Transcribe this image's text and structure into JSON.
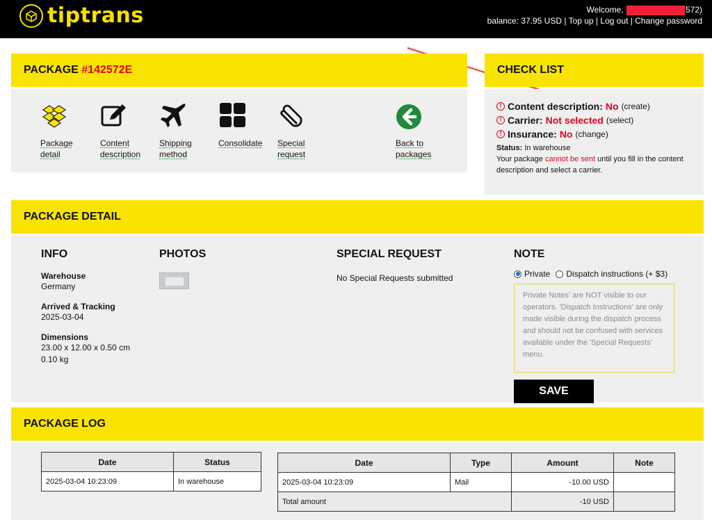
{
  "header": {
    "brand": "tiptrans",
    "welcome_prefix": "Welcome,",
    "welcome_suffix": "572)",
    "balance": "balance: 37.95 USD",
    "links": [
      "Top up",
      "Log out",
      "Change password"
    ]
  },
  "package": {
    "title_prefix": "PACKAGE",
    "id": "#142572E",
    "nav": [
      {
        "label_1": "Package",
        "label_2": "detail",
        "icon": "boxes-icon"
      },
      {
        "label_1": "Content",
        "label_2": "description",
        "icon": "edit-icon"
      },
      {
        "label_1": "Shipping",
        "label_2": "method",
        "icon": "airplane-icon"
      },
      {
        "label_1": "Consolidate",
        "label_2": "",
        "icon": "grid-icon"
      },
      {
        "label_1": "Special",
        "label_2": "request",
        "icon": "paperclip-icon"
      },
      {
        "label_1": "Back to",
        "label_2": "packages",
        "icon": "back-arrow-icon"
      }
    ]
  },
  "checklist": {
    "title": "CHECK LIST",
    "content_label": "Content description:",
    "content_value": "No",
    "content_action": "(create)",
    "carrier_label": "Carrier:",
    "carrier_value": "Not selected",
    "carrier_action": "(select)",
    "insurance_label": "Insurance:",
    "insurance_value": "No",
    "insurance_action": "(change)",
    "status_label": "Status:",
    "status_value": "In warehouse",
    "note_1": "Your package",
    "note_red": "cannot be sent",
    "note_2": "until you fill in the",
    "note_3": "content description and select a carrier."
  },
  "detail": {
    "title": "PACKAGE DETAIL",
    "info_title": "INFO",
    "warehouse_label": "Warehouse",
    "warehouse_value": "Germany",
    "arrived_label": "Arrived & Tracking",
    "arrived_value": "2025-03-04",
    "dimensions_label": "Dimensions",
    "dimensions_value": "23.00 x 12.00 x 0.50 cm",
    "weight_value": "0.10 kg",
    "photos_title": "PHOTOS",
    "special_title": "SPECIAL REQUEST",
    "special_value": "No Special Requests submitted",
    "note_title": "NOTE",
    "radio_private": "Private",
    "radio_dispatch": "Dispatch instructions (+ $3)",
    "note_placeholder": "Private Notes' are NOT visible to our operators. 'Dispatch Instructions' are only made visible during the dispatch process and should not be confused with services available under the 'Special Requests' menu.",
    "save_label": "SAVE"
  },
  "log": {
    "title": "PACKAGE LOG",
    "status_table": {
      "headers": [
        "Date",
        "Status"
      ],
      "rows": [
        [
          "2025-03-04 10:23:09",
          "In warehouse"
        ]
      ]
    },
    "payment_table": {
      "headers": [
        "Date",
        "Type",
        "Amount",
        "Note"
      ],
      "rows": [
        [
          "2025-03-04 10:23:09",
          "Mail",
          "-10.00 USD",
          ""
        ]
      ],
      "total_label": "Total amount",
      "total_value": "-10 USD"
    }
  },
  "colors": {
    "accent": "#f8e400",
    "alert": "#e3001b",
    "back_button": "#1f8a3a"
  }
}
